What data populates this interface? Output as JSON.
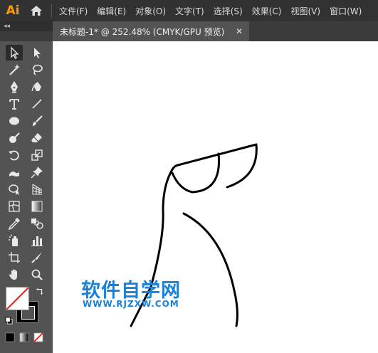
{
  "app": {
    "logo_text": "Ai"
  },
  "menu": {
    "items": [
      {
        "label": "文件(F)"
      },
      {
        "label": "编辑(E)"
      },
      {
        "label": "对象(O)"
      },
      {
        "label": "文字(T)"
      },
      {
        "label": "选择(S)"
      },
      {
        "label": "效果(C)"
      },
      {
        "label": "视图(V)"
      },
      {
        "label": "窗口(W)"
      }
    ]
  },
  "panel": {
    "collapse_label": "◂◂"
  },
  "document_tab": {
    "title": "未标题-1* @ 252.48% (CMYK/GPU 预览)",
    "close_glyph": "✕"
  },
  "toolbar": {
    "tools": [
      "selection-tool",
      "direct-selection-tool",
      "magic-wand-tool",
      "lasso-tool",
      "pen-tool",
      "curvature-tool",
      "type-tool",
      "line-segment-tool",
      "ellipse-tool",
      "paintbrush-tool",
      "blob-brush-tool",
      "eraser-tool",
      "rotate-tool",
      "scale-tool",
      "warp-tool",
      "puppet-warp-tool",
      "shape-builder-tool",
      "perspective-grid-tool",
      "mesh-tool",
      "gradient-tool",
      "eyedropper-tool",
      "blend-tool",
      "symbol-sprayer-tool",
      "column-graph-tool",
      "artboard-tool",
      "slice-tool",
      "hand-tool",
      "zoom-tool"
    ],
    "selected_tool": "selection-tool",
    "fill_color": "#ffffff",
    "stroke_color": "#000000"
  },
  "canvas": {
    "background": "#ffffff",
    "watermark_title": "软件自学网",
    "watermark_url": "WWW.RJZXW.COM",
    "watermark_color": "#1a80d8"
  }
}
